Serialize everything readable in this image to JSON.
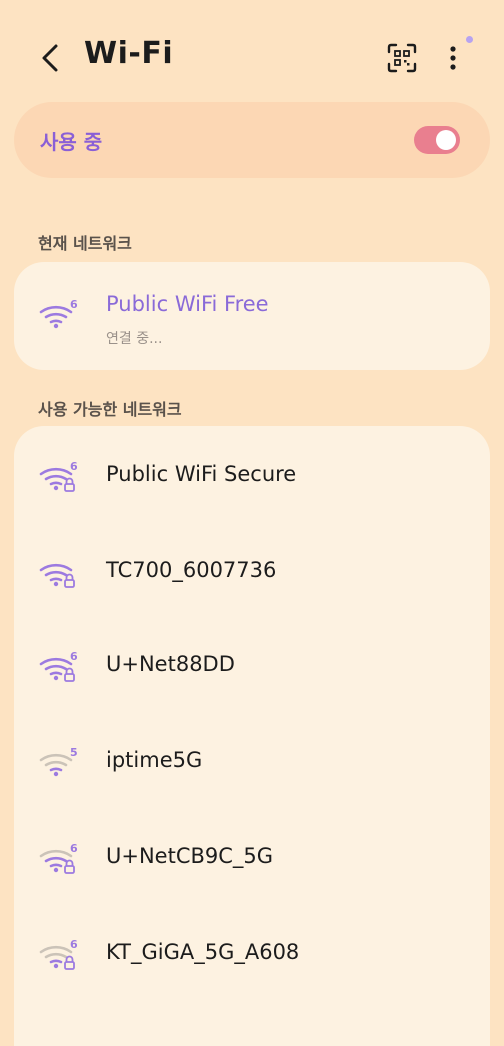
{
  "header": {
    "title": "Wi-Fi"
  },
  "master": {
    "label": "사용 중",
    "on": true
  },
  "current_section": {
    "title": "현재 네트워크",
    "network": {
      "name": "Public WiFi Free",
      "status": "연결 중...",
      "wifi_standard": "6",
      "secured": false
    }
  },
  "available_section": {
    "title": "사용 가능한 네트워크",
    "networks": [
      {
        "name": "Public WiFi Secure",
        "wifi_standard": "6",
        "secured": true,
        "signal": "strong"
      },
      {
        "name": "TC700_6007736",
        "wifi_standard": "",
        "secured": true,
        "signal": "strong"
      },
      {
        "name": "U+Net88DD",
        "wifi_standard": "6",
        "secured": true,
        "signal": "strong"
      },
      {
        "name": "iptime5G",
        "wifi_standard": "5",
        "secured": false,
        "signal": "weak"
      },
      {
        "name": "U+NetCB9C_5G",
        "wifi_standard": "6",
        "secured": true,
        "signal": "medium"
      },
      {
        "name": "KT_GiGA_5G_A608",
        "wifi_standard": "6",
        "secured": true,
        "signal": "weak"
      }
    ]
  },
  "colors": {
    "background": "#fde3c2",
    "accent": "#8a5fd6",
    "toggle_on": "#e97f8f",
    "card": "#fdf2e1",
    "wifi_strong": "#9c7ae0",
    "wifi_weak": "#cbc3b8"
  },
  "icons": {
    "back": "chevron-left-icon",
    "qr": "qr-code-scan-icon",
    "more": "more-vertical-icon",
    "wifi": "wifi-signal-icon",
    "lock": "lock-icon"
  }
}
